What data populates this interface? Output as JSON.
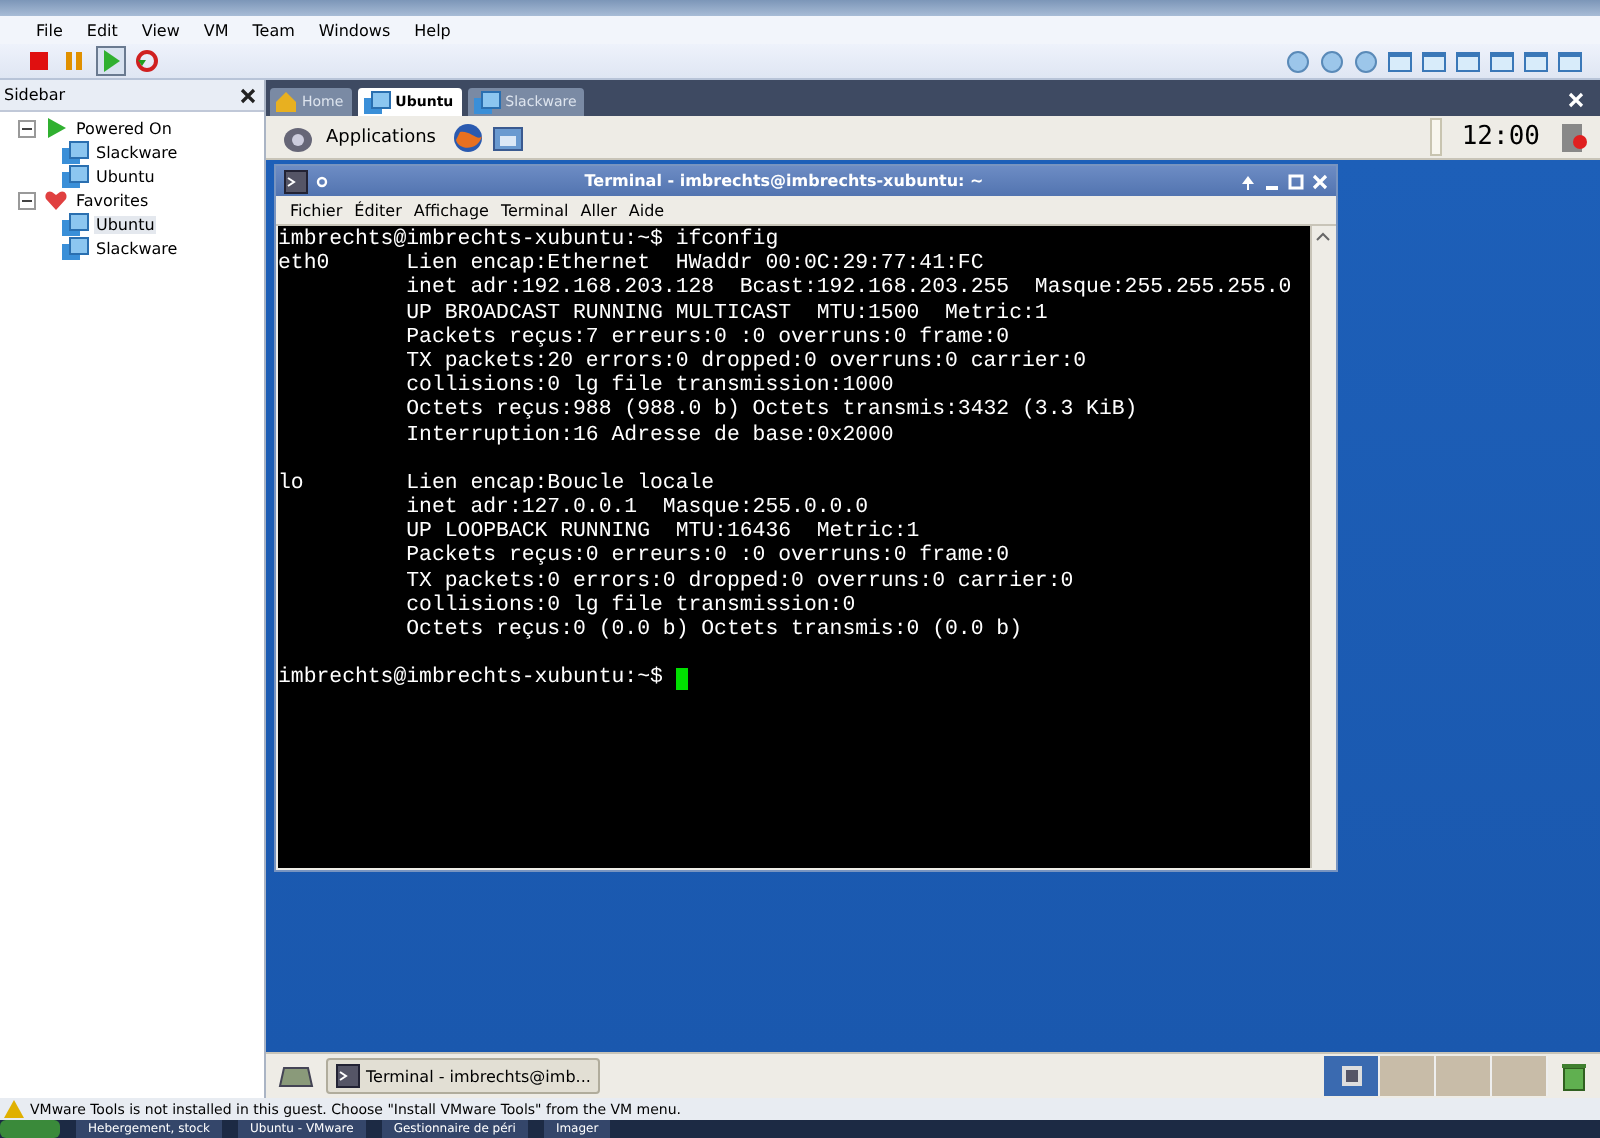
{
  "menu": [
    "File",
    "Edit",
    "View",
    "VM",
    "Team",
    "Windows",
    "Help"
  ],
  "toolbar": [
    {
      "kind": "stop",
      "selected": false
    },
    {
      "kind": "pause",
      "selected": false
    },
    {
      "kind": "play",
      "selected": true
    },
    {
      "kind": "reset",
      "selected": false
    }
  ],
  "sidebar": {
    "title": "Sidebar",
    "groups": [
      {
        "label": "Powered On",
        "kind": "powered",
        "expanded": true,
        "children": [
          {
            "label": "Slackware",
            "selected": false
          },
          {
            "label": "Ubuntu",
            "selected": false
          }
        ]
      },
      {
        "label": "Favorites",
        "kind": "favorites",
        "expanded": true,
        "children": [
          {
            "label": "Ubuntu",
            "selected": true
          },
          {
            "label": "Slackware",
            "selected": false
          }
        ]
      }
    ]
  },
  "tabs": [
    {
      "label": "Home",
      "kind": "home",
      "selected": false
    },
    {
      "label": "Ubuntu",
      "kind": "vm",
      "selected": true
    },
    {
      "label": "Slackware",
      "kind": "vm",
      "selected": false
    }
  ],
  "guest_panel": {
    "applications": "Applications",
    "clock": "12:00"
  },
  "terminal": {
    "title": "Terminal - imbrechts@imbrechts-xubuntu: ~",
    "menu": [
      "Fichier",
      "Éditer",
      "Affichage",
      "Terminal",
      "Aller",
      "Aide"
    ],
    "blocks": [
      [
        "imbrechts@imbrechts-xubuntu:~$ ifconfig",
        "eth0      Lien encap:Ethernet  HWaddr 00:0C:29:77:41:FC",
        "          inet adr:192.168.203.128  Bcast:192.168.203.255  Masque:255.255.255.0",
        "          UP BROADCAST RUNNING MULTICAST  MTU:1500  Metric:1",
        "          Packets reçus:7 erreurs:0 :0 overruns:0 frame:0",
        "          TX packets:20 errors:0 dropped:0 overruns:0 carrier:0",
        "          collisions:0 lg file transmission:1000",
        "          Octets reçus:988 (988.0 b) Octets transmis:3432 (3.3 KiB)",
        "          Interruption:16 Adresse de base:0x2000"
      ],
      [
        "lo        Lien encap:Boucle locale",
        "          inet adr:127.0.0.1  Masque:255.0.0.0",
        "          UP LOOPBACK RUNNING  MTU:16436  Metric:1",
        "          Packets reçus:0 erreurs:0 :0 overruns:0 frame:0",
        "          TX packets:0 errors:0 dropped:0 overruns:0 carrier:0",
        "          collisions:0 lg file transmission:0",
        "          Octets reçus:0 (0.0 b) Octets transmis:0 (0.0 b)"
      ],
      [
        "imbrechts@imbrechts-xubuntu:~$ "
      ]
    ]
  },
  "guest_taskbar": {
    "task": "Terminal - imbrechts@imb..."
  },
  "status": "VMware Tools is not installed in this guest. Choose \"Install VMware Tools\" from the VM menu.",
  "host_taskbar": [
    "Hebergement, stock",
    "Ubuntu - VMware",
    "Gestionnaire de péri",
    "Imager"
  ]
}
